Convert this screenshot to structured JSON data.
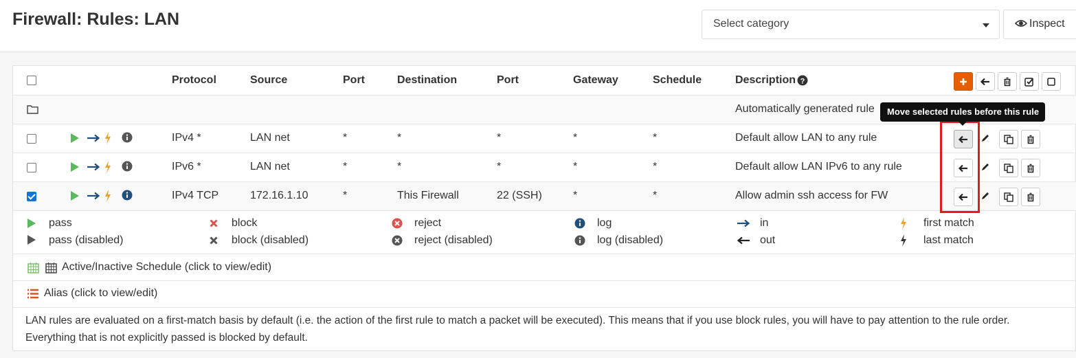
{
  "header": {
    "title": "Firewall: Rules: LAN",
    "category_placeholder": "Select category",
    "inspect_label": "Inspect"
  },
  "table": {
    "columns": [
      "Protocol",
      "Source",
      "Port",
      "Destination",
      "Port",
      "Gateway",
      "Schedule",
      "Description"
    ],
    "auto_row": {
      "description": "Automatically generated rule"
    },
    "rows": [
      {
        "checked": false,
        "protocol": "IPv4 *",
        "source": "LAN net",
        "src_port": "*",
        "destination": "*",
        "dst_port": "*",
        "gateway": "*",
        "schedule": "*",
        "description": "Default allow LAN to any rule"
      },
      {
        "checked": false,
        "protocol": "IPv6 *",
        "source": "LAN net",
        "src_port": "*",
        "destination": "*",
        "dst_port": "*",
        "gateway": "*",
        "schedule": "*",
        "description": "Default allow LAN IPv6 to any rule"
      },
      {
        "checked": true,
        "protocol": "IPv4 TCP",
        "source": "172.16.1.10",
        "src_port": "*",
        "destination": "This Firewall",
        "dst_port": "22 (SSH)",
        "gateway": "*",
        "schedule": "*",
        "description": "Allow admin ssh access for FW"
      }
    ]
  },
  "tooltip": "Move selected rules before this rule",
  "legend": {
    "pass": "pass",
    "pass_disabled": "pass (disabled)",
    "block": "block",
    "block_disabled": "block (disabled)",
    "reject": "reject",
    "reject_disabled": "reject (disabled)",
    "log": "log",
    "log_disabled": "log (disabled)",
    "in": "in",
    "out": "out",
    "first_match": "first match",
    "last_match": "last match"
  },
  "schedule_note": "Active/Inactive Schedule (click to view/edit)",
  "alias_note": "Alias (click to view/edit)",
  "footer_note": "LAN rules are evaluated on a first-match basis by default (i.e. the action of the first rule to match a packet will be executed). This means that if you use block rules, you will have to pay attention to the rule order. Everything that is not explicitly passed is blocked by default.",
  "colors": {
    "pass": "#5cb85c",
    "in_arrow": "#1f4f7a",
    "match_bolt": "#f0a030",
    "add_button": "#e65c00",
    "highlight_box": "#e41b1b",
    "alias_icon": "#d9531e"
  }
}
